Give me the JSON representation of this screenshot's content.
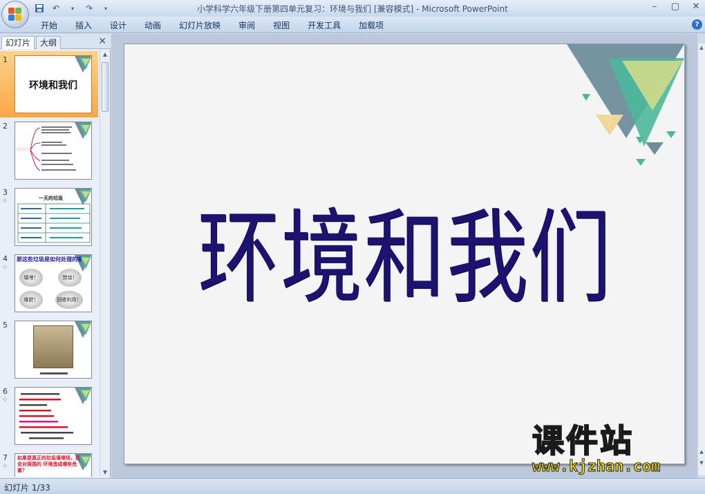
{
  "window": {
    "title": "小学科学六年级下册第四单元复习：环境与我们 [兼容模式] - Microsoft PowerPoint",
    "controls": [
      "–",
      "▢",
      "✕"
    ]
  },
  "ribbon": {
    "tabs": [
      "开始",
      "插入",
      "设计",
      "动画",
      "幻灯片放映",
      "审阅",
      "视图",
      "开发工具",
      "加载项"
    ],
    "help_icon": "help-icon"
  },
  "left_pane": {
    "tabs": {
      "slides": "幻灯片",
      "outline": "大纲"
    },
    "close": "✕",
    "thumbnails": [
      {
        "num": "1",
        "title": "环境和我们",
        "selected": true
      },
      {
        "num": "2"
      },
      {
        "num": "3",
        "heading": "一天的垃圾"
      },
      {
        "num": "4",
        "heading": "那这些垃圾是如何处理的呢？",
        "bubbles": [
          "填埋！",
          "焚烧！",
          "堆肥！",
          "回收利用！"
        ]
      },
      {
        "num": "5"
      },
      {
        "num": "6"
      },
      {
        "num": "7",
        "heading": "如果是真正的垃圾填埋场，还会对周围的 环境造成哪些危害？"
      }
    ]
  },
  "slide": {
    "title": "环境和我们",
    "accent_colors": [
      "#6e8d9b",
      "#4bb89a",
      "#c9d98b",
      "#f0d89a"
    ]
  },
  "watermark": {
    "brand": "课件站",
    "url": "www.kjzhan.com"
  },
  "status": {
    "text": "幻灯片 1/33"
  }
}
